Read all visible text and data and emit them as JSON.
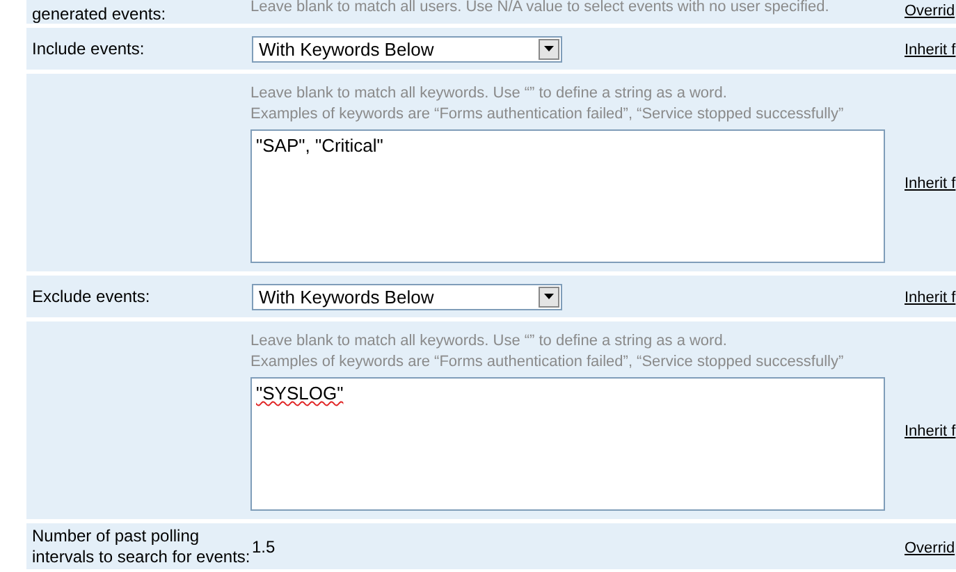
{
  "rows": [
    {
      "kind": "text",
      "label": "generated events:",
      "hint": "Leave blank to match all users. Use N/A value to select events with no user specified.",
      "link": "Overrid"
    },
    {
      "kind": "select",
      "label": "Include events:",
      "value": "With Keywords Below",
      "link": "Inherit f"
    },
    {
      "kind": "textarea",
      "hints": [
        "Leave blank to match all keywords. Use “” to define a string as a word.",
        "Examples of keywords are “Forms authentication failed”, “Service stopped successfully”"
      ],
      "value": "\"SAP\", \"Critical\"",
      "misspelled": false,
      "link": "Inherit f"
    },
    {
      "kind": "select",
      "label": "Exclude events:",
      "value": "With Keywords Below",
      "link": "Inherit f"
    },
    {
      "kind": "textarea",
      "hints": [
        "Leave blank to match all keywords. Use “” to define a string as a word.",
        "Examples of keywords are “Forms authentication failed”, “Service stopped successfully”"
      ],
      "value": "\"SYSLOG\"",
      "misspelled": true,
      "link": "Inherit f"
    },
    {
      "kind": "value",
      "label": "Number of past polling intervals to search for events:",
      "value": "1.5",
      "link": "Overrid"
    }
  ]
}
